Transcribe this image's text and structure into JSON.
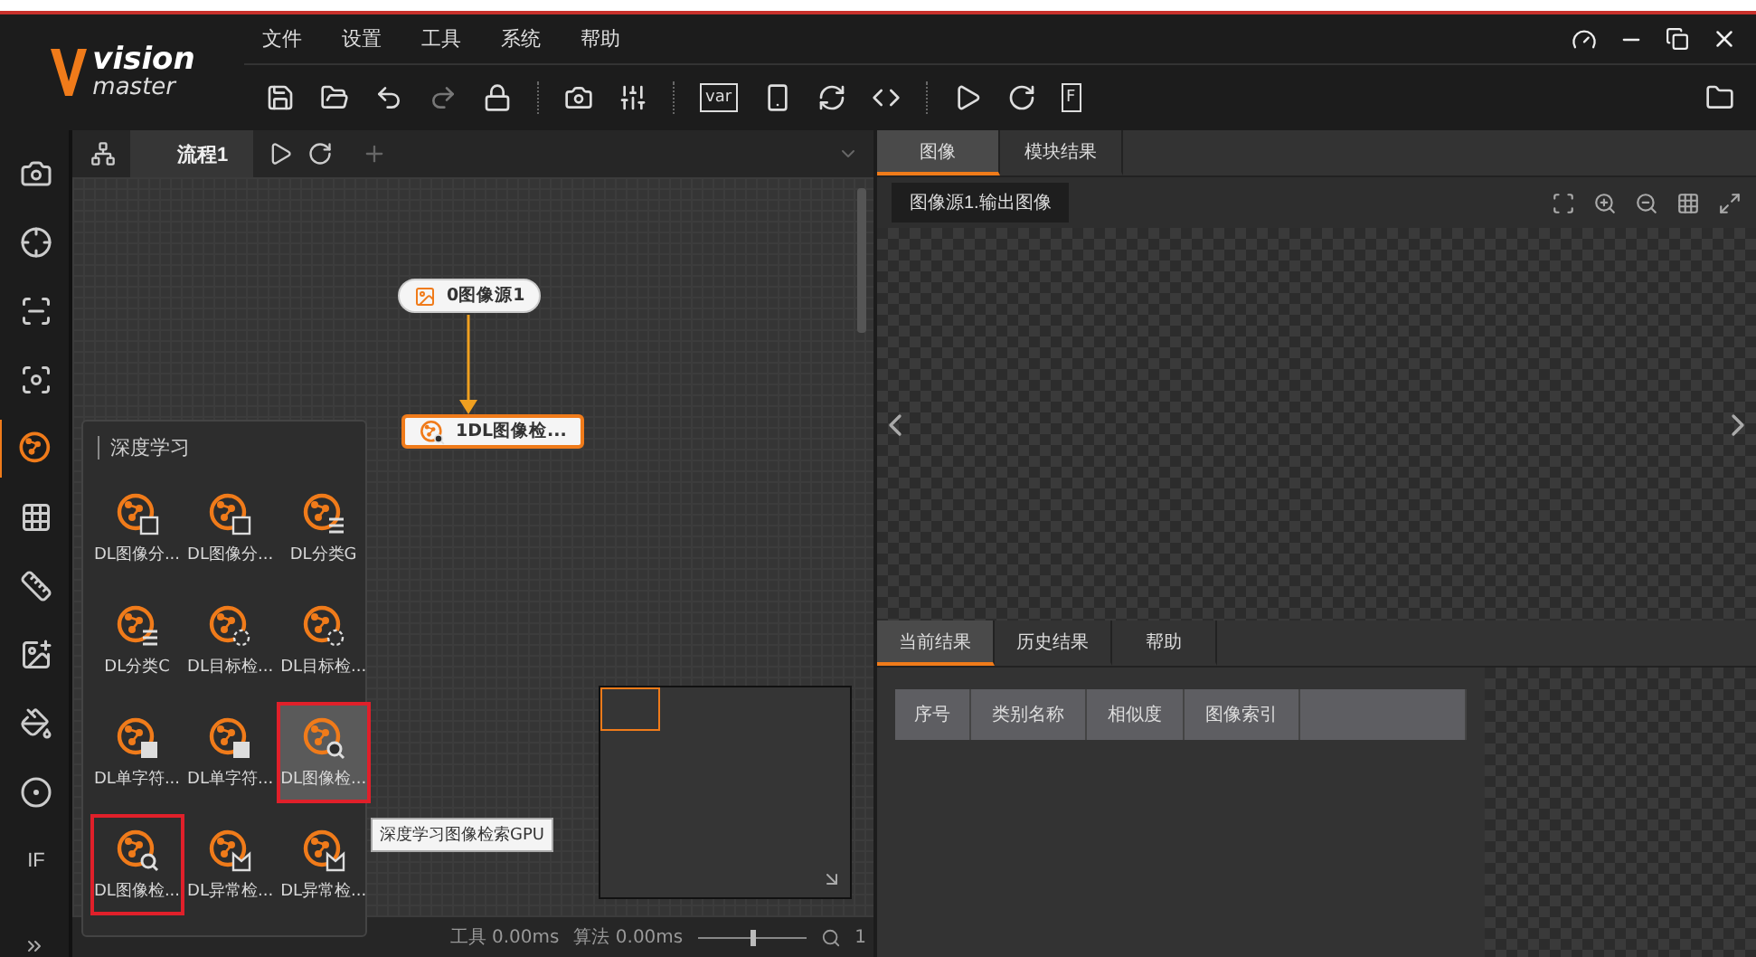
{
  "logo": {
    "line1": "vision",
    "line2": "master"
  },
  "menu": [
    "文件",
    "设置",
    "工具",
    "系统",
    "帮助"
  ],
  "toolbar": {
    "var_label": "var",
    "f_label": "F"
  },
  "rail": [
    {
      "selected": false
    },
    {
      "selected": false
    },
    {
      "selected": false
    },
    {
      "selected": false
    },
    {
      "selected": true
    },
    {
      "selected": false
    },
    {
      "selected": false
    },
    {
      "selected": false
    },
    {
      "selected": false
    },
    {
      "selected": false
    },
    {
      "selected": false,
      "label": "IF"
    }
  ],
  "flow_tabs": [
    {
      "label": "流程1",
      "selected": true
    }
  ],
  "nodes": [
    {
      "label": "0图像源1",
      "kind": "source",
      "selected": false
    },
    {
      "label": "1DL图像检...",
      "kind": "dl",
      "selected": true
    }
  ],
  "palette": {
    "title": "深度学习",
    "tooltip": "深度学习图像检索GPU",
    "items": [
      {
        "label": "DL图像分...",
        "kind": "segment",
        "hovered": false,
        "highlighted": false
      },
      {
        "label": "DL图像分...",
        "kind": "segment",
        "hovered": false,
        "highlighted": false
      },
      {
        "label": "DL分类G",
        "kind": "classify",
        "hovered": false,
        "highlighted": false
      },
      {
        "label": "DL分类C",
        "kind": "classify",
        "hovered": false,
        "highlighted": false
      },
      {
        "label": "DL目标检...",
        "kind": "detect",
        "hovered": false,
        "highlighted": false
      },
      {
        "label": "DL目标检...",
        "kind": "detect",
        "hovered": false,
        "highlighted": false
      },
      {
        "label": "DL单字符...",
        "kind": "char",
        "hovered": false,
        "highlighted": false
      },
      {
        "label": "DL单字符...",
        "kind": "char",
        "hovered": false,
        "highlighted": false
      },
      {
        "label": "DL图像检...",
        "kind": "search",
        "hovered": true,
        "highlighted": true
      },
      {
        "label": "DL图像检...",
        "kind": "search",
        "hovered": false,
        "highlighted": true
      },
      {
        "label": "DL异常检...",
        "kind": "anomaly",
        "hovered": false,
        "highlighted": false
      },
      {
        "label": "DL异常检...",
        "kind": "anomaly",
        "hovered": false,
        "highlighted": false
      }
    ]
  },
  "status_bar": {
    "tool_label": "工具",
    "tool_time": "0.00ms",
    "algo_label": "算法",
    "algo_time": "0.00ms",
    "zoom": {
      "level": 0.5
    },
    "zoom_value": "1"
  },
  "image_tabs": [
    {
      "label": "图像",
      "selected": true
    },
    {
      "label": "模块结果",
      "selected": false
    }
  ],
  "image_source": "图像源1.输出图像",
  "result_tabs": [
    {
      "label": "当前结果",
      "selected": true
    },
    {
      "label": "历史结果",
      "selected": false
    },
    {
      "label": "帮助",
      "selected": false
    }
  ],
  "table": {
    "columns": [
      "序号",
      "类别名称",
      "相似度",
      "图像索引"
    ]
  }
}
